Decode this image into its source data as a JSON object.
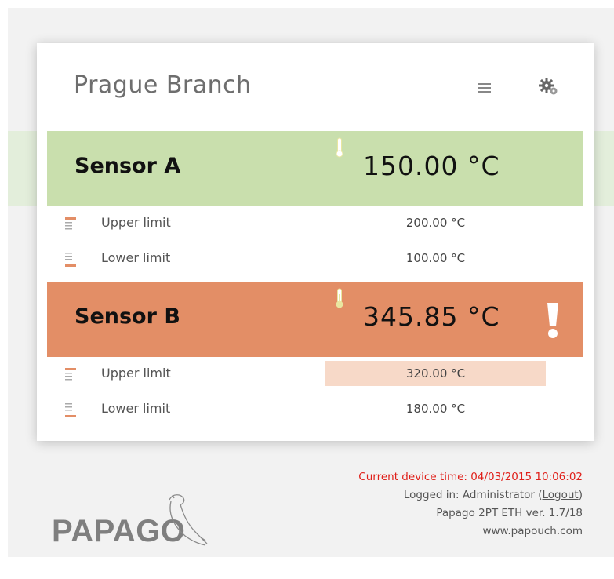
{
  "branch": {
    "title": "Prague Branch"
  },
  "sensors": [
    {
      "name": "Sensor A",
      "temperature": "150.00 °C",
      "status_color": "#c9dfad",
      "alert": false,
      "upper": {
        "label": "Upper limit",
        "value": "200.00 °C",
        "highlighted": false
      },
      "lower": {
        "label": "Lower limit",
        "value": "100.00 °C",
        "highlighted": false
      }
    },
    {
      "name": "Sensor B",
      "temperature": "345.85 °C",
      "status_color": "#e38e66",
      "alert": true,
      "upper": {
        "label": "Upper limit",
        "value": "320.00 °C",
        "highlighted": true
      },
      "lower": {
        "label": "Lower limit",
        "value": "180.00 °C",
        "highlighted": false
      }
    }
  ],
  "icons": {
    "menu": "menu-icon",
    "settings": "gear-icon",
    "thermometer": "thermometer-icon",
    "upper_limit": "upper-limit-icon",
    "lower_limit": "lower-limit-icon",
    "alert": "exclamation-icon"
  },
  "footer": {
    "device_time": "Current device time: 04/03/2015 10:06:02",
    "logged_in_prefix": "Logged in: Administrator (",
    "logout_label": "Logout",
    "logged_in_suffix": ")",
    "version": "Papago 2PT ETH ver. 1.7/18",
    "website": "www.papouch.com"
  },
  "logo": {
    "text": "PAPAGO"
  }
}
